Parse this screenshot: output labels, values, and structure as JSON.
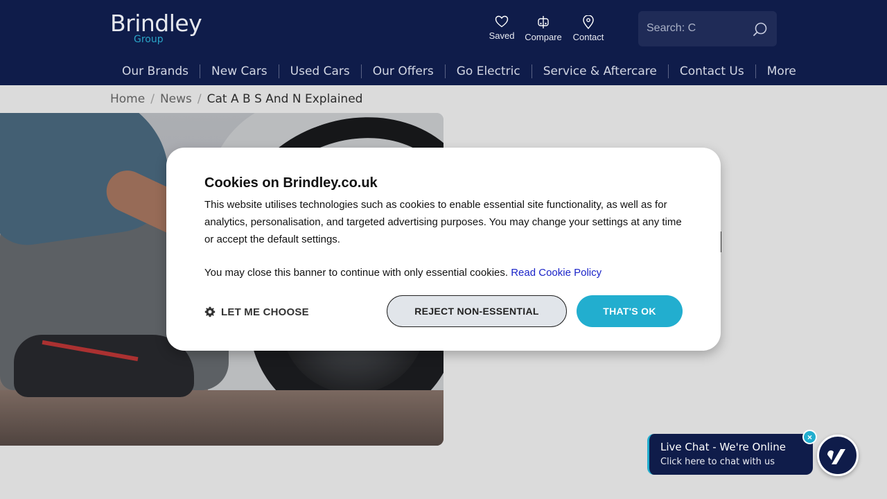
{
  "brand": {
    "logo_main": "Brindley",
    "logo_sub": "Group"
  },
  "header_links": [
    {
      "label": "Saved",
      "icon": "heart-icon"
    },
    {
      "label": "Compare",
      "icon": "compare-icon"
    },
    {
      "label": "Contact",
      "icon": "location-pin-icon"
    }
  ],
  "search": {
    "placeholder": "Search: C",
    "icon": "search-icon"
  },
  "nav": [
    "Our Brands",
    "New Cars",
    "Used Cars",
    "Our Offers",
    "Go Electric",
    "Service & Aftercare",
    "Contact Us",
    "More"
  ],
  "breadcrumb": {
    "items": [
      "Home",
      "News"
    ],
    "separator": "/",
    "current": "Cat A B S And N Explained"
  },
  "cookie_banner": {
    "title": "Cookies on Brindley.co.uk",
    "body": "This website utilises technologies such as cookies to enable essential site functionality, as well as for analytics, personalisation, and targeted advertising purposes. You may change your settings at any time or accept the default settings.",
    "close_note": "You may close this banner to continue with only essential cookies.",
    "policy_link": "Read Cookie Policy",
    "choose_label": "LET ME CHOOSE",
    "reject_label": "REJECT NON-ESSENTIAL",
    "accept_label": "THAT'S OK"
  },
  "live_chat": {
    "title": "Live Chat - We're Online",
    "subtitle": "Click here to chat with us",
    "close": "×"
  },
  "colors": {
    "header_bg": "#0f1c4a",
    "accent": "#22aecf",
    "link": "#1a23c8"
  }
}
